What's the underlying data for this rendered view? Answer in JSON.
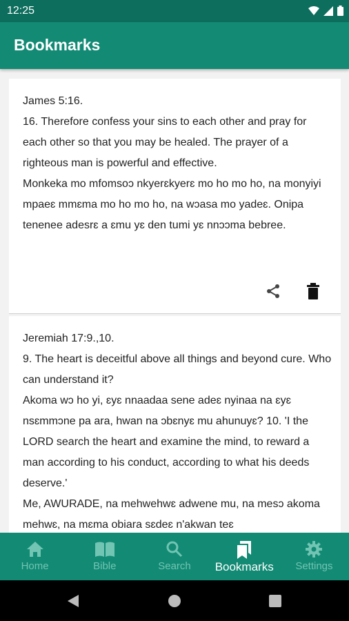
{
  "status": {
    "time": "12:25"
  },
  "appbar": {
    "title": "Bookmarks"
  },
  "bookmarks": [
    {
      "text": "James 5:16.\n16. Therefore confess your sins to each other and pray for each other so that you may be healed. The prayer of a righteous man is powerful and effective.\nMonkeka mo mfomsoɔ nkyerɛkyerɛ mo ho mo ho, na monyiyi mpaeɛ mmɛma mo ho mo ho, na wɔasa mo yadeɛ. Onipa tenenee adesrɛ a ɛmu yɛ den tumi yɛ nnɔɔma bebree."
    },
    {
      "text": "Jeremiah 17:9.,10.\n9. The heart is deceitful above all things and beyond cure. Who can understand it?\nAkoma wɔ ho yi, ɛyɛ nnaadaa sene adeɛ nyinaa na ɛyɛ nsɛmmɔne pa ara, hwan na ɔbɛnyɛ mu ahunuyɛ? 10. 'I the LORD search the heart and examine the mind, to reward a man according to his conduct, according to what his deeds deserve.'\nMe, AWURADE, na mehwehwɛ adwene mu, na mesɔ akoma mehwɛ, na mɛma obiara sɛdeɛ n'akwan teɛ"
    }
  ],
  "nav": {
    "home": "Home",
    "bible": "Bible",
    "search": "Search",
    "bookmarks": "Bookmarks",
    "settings": "Settings"
  },
  "colors": {
    "primary": "#128a74",
    "status": "#0d6e5e",
    "inactive": "#72c4b3"
  }
}
